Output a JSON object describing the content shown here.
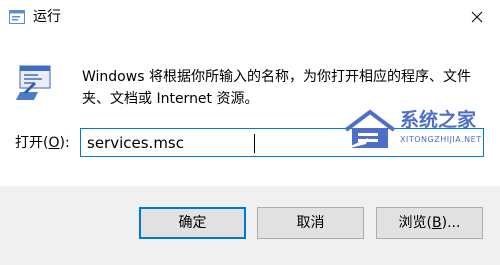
{
  "window": {
    "title": "运行",
    "icon": "run-dialog-icon",
    "close_icon": "close-icon"
  },
  "dialog": {
    "icon": "run-app-icon",
    "description": "Windows 将根据你所输入的名称，为你打开相应的程序、文件夹、文档或 Internet 资源。",
    "open_label_prefix": "打开(",
    "open_label_key": "O",
    "open_label_suffix": "):",
    "open_value": "services.msc"
  },
  "buttons": {
    "ok": "确定",
    "cancel": "取消",
    "browse_prefix": "浏览(",
    "browse_key": "B",
    "browse_suffix": ")..."
  },
  "watermark": {
    "title": "系统之家",
    "subtitle": "XITONGZHIJIA.NET",
    "logo": "house-logo-icon"
  },
  "colors": {
    "accent": "#0078d7",
    "footer_bg": "#f0f0f0",
    "button_bg": "#e1e1e1",
    "watermark": "#4f6fc7"
  }
}
